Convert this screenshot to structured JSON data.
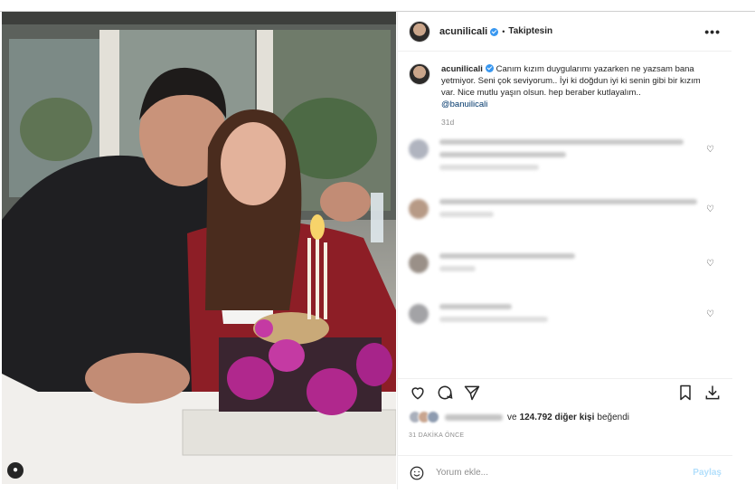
{
  "post": {
    "username": "acunilicali",
    "separator": "•",
    "follow_status": "Takiptesin",
    "more_label": "•••"
  },
  "caption": {
    "username": "acunilicali",
    "text": "Canım kızım duygularımı yazarken ne yazsam bana yetmiyor. Seni çok seviyorum.. İyi ki doğdun iyi ki senin gibi bir kızım var. Nice mutlu yaşın olsun. hep beraber kutlayalım..",
    "mention": "@banuilicali",
    "time": "31d"
  },
  "likes": {
    "prefix": "ve",
    "count": "124.792 diğer kişi",
    "suffix": "beğendi"
  },
  "posted_ago": "31 DAKİKA ÖNCE",
  "comment_box": {
    "placeholder": "Yorum ekle...",
    "share_label": "Paylaş"
  },
  "icons": {
    "like": "heart-icon",
    "comment": "comment-icon",
    "share": "paper-plane-icon",
    "save": "bookmark-icon",
    "download": "download-icon",
    "emoji": "emoji-icon"
  },
  "colors": {
    "verified": "#3897f0",
    "mention": "#00376b",
    "muted": "#8e8e8e",
    "share_disabled": "#b2dffc"
  }
}
